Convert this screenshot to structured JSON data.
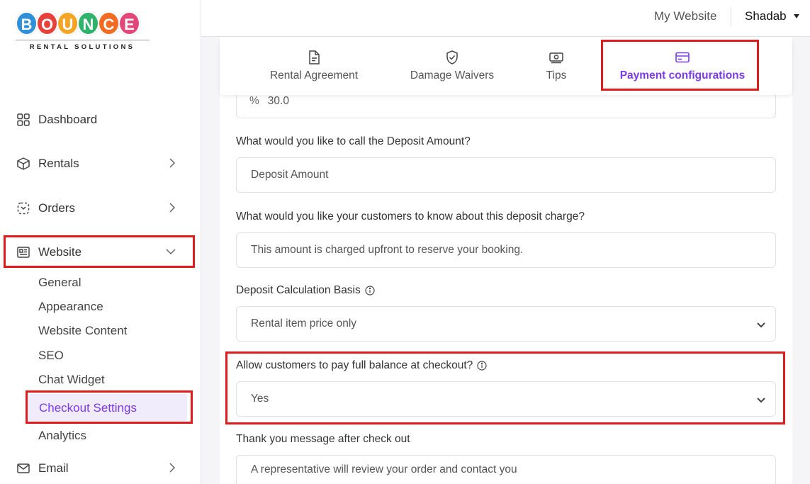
{
  "logo": {
    "letters": [
      "B",
      "O",
      "U",
      "N",
      "C",
      "E"
    ],
    "letter_colors": [
      "#2f8fd8",
      "#e8413b",
      "#f5a524",
      "#2fb36b",
      "#f36b21",
      "#e2477a"
    ],
    "subtitle": "RENTAL SOLUTIONS"
  },
  "sidebar": {
    "dashboard": "Dashboard",
    "rentals": "Rentals",
    "orders": "Orders",
    "website": "Website",
    "website_sub": [
      "General",
      "Appearance",
      "Website Content",
      "SEO",
      "Chat Widget",
      "Checkout Settings",
      "Analytics"
    ],
    "email": "Email"
  },
  "topbar": {
    "site_link": "My Website",
    "user": "Shadab"
  },
  "tabs": [
    {
      "label": "Rental Agreement",
      "icon": "document-icon"
    },
    {
      "label": "Damage Waivers",
      "icon": "shield-check-icon"
    },
    {
      "label": "Tips",
      "icon": "cash-icon"
    },
    {
      "label": "Payment configurations",
      "icon": "credit-card-icon",
      "active": true
    }
  ],
  "form": {
    "percent_symbol": "%",
    "percent_value": "30.0",
    "deposit_name_label": "What would you like to call the Deposit Amount?",
    "deposit_name_value": "Deposit Amount",
    "deposit_note_label": "What would you like your customers to know about this deposit charge?",
    "deposit_note_value": "This amount is charged upfront to reserve your booking.",
    "calc_basis_label": "Deposit Calculation Basis",
    "calc_basis_value": "Rental item price only",
    "full_balance_label": "Allow customers to pay full balance at checkout?",
    "full_balance_value": "Yes",
    "thank_you_label": "Thank you message after check out",
    "thank_you_value": "A representative will review your order and contact you"
  },
  "colors": {
    "accent": "#7c3aed",
    "highlight": "#e01b1b"
  }
}
